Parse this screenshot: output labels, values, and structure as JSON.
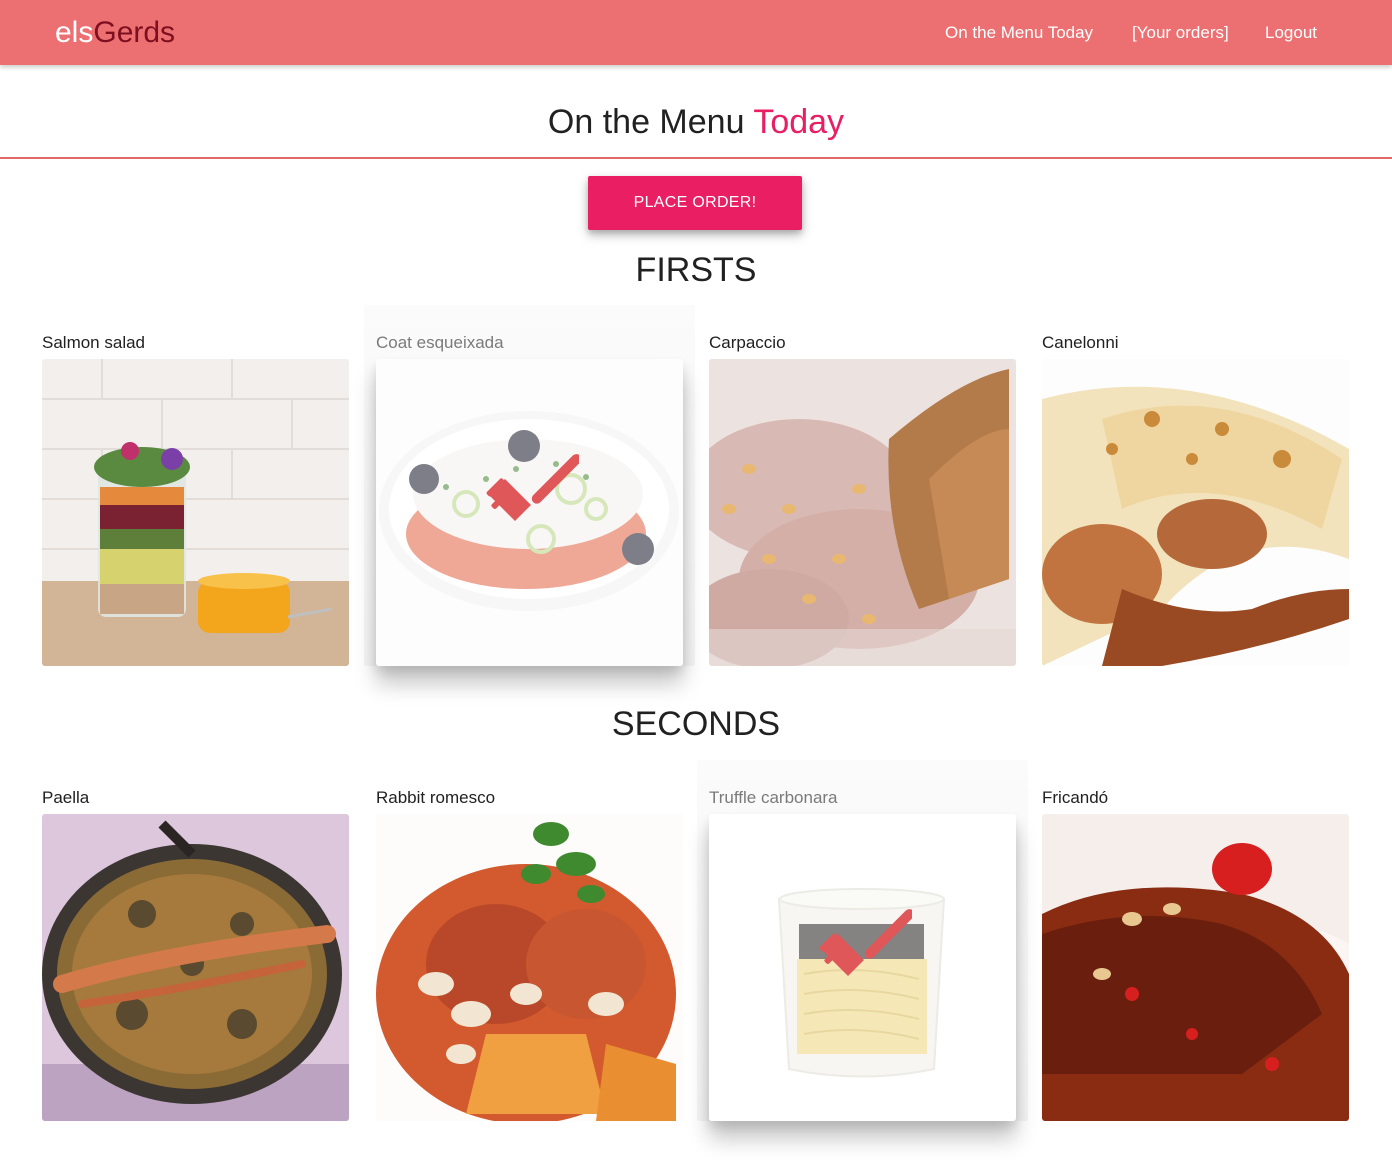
{
  "navbar": {
    "brand_prefix": "els",
    "brand_suffix": "Gerds",
    "links": [
      {
        "label": "On the Menu Today"
      },
      {
        "label": "[Your orders]"
      },
      {
        "label": "Logout"
      }
    ]
  },
  "page": {
    "title_main": "On the Menu ",
    "title_accent": "Today",
    "place_order_label": "PLACE ORDER!"
  },
  "sections": [
    {
      "heading": "FIRSTS",
      "items": [
        {
          "name": "Salmon salad",
          "selected": false
        },
        {
          "name": "Coat esqueixada",
          "selected": true
        },
        {
          "name": "Carpaccio",
          "selected": false
        },
        {
          "name": "Canelonni",
          "selected": false
        }
      ]
    },
    {
      "heading": "SECONDS",
      "items": [
        {
          "name": "Paella",
          "selected": false
        },
        {
          "name": "Rabbit romesco",
          "selected": false
        },
        {
          "name": "Truffle carbonara",
          "selected": true
        },
        {
          "name": "Fricandó",
          "selected": false
        }
      ]
    }
  ],
  "colors": {
    "navbar": "#ec7072",
    "brand_accent": "#7d0f1f",
    "accent": "#e91e63",
    "rule": "#e26b66",
    "fork": "#e0575a"
  },
  "icons": {
    "selected_marker": "fork-icon"
  }
}
